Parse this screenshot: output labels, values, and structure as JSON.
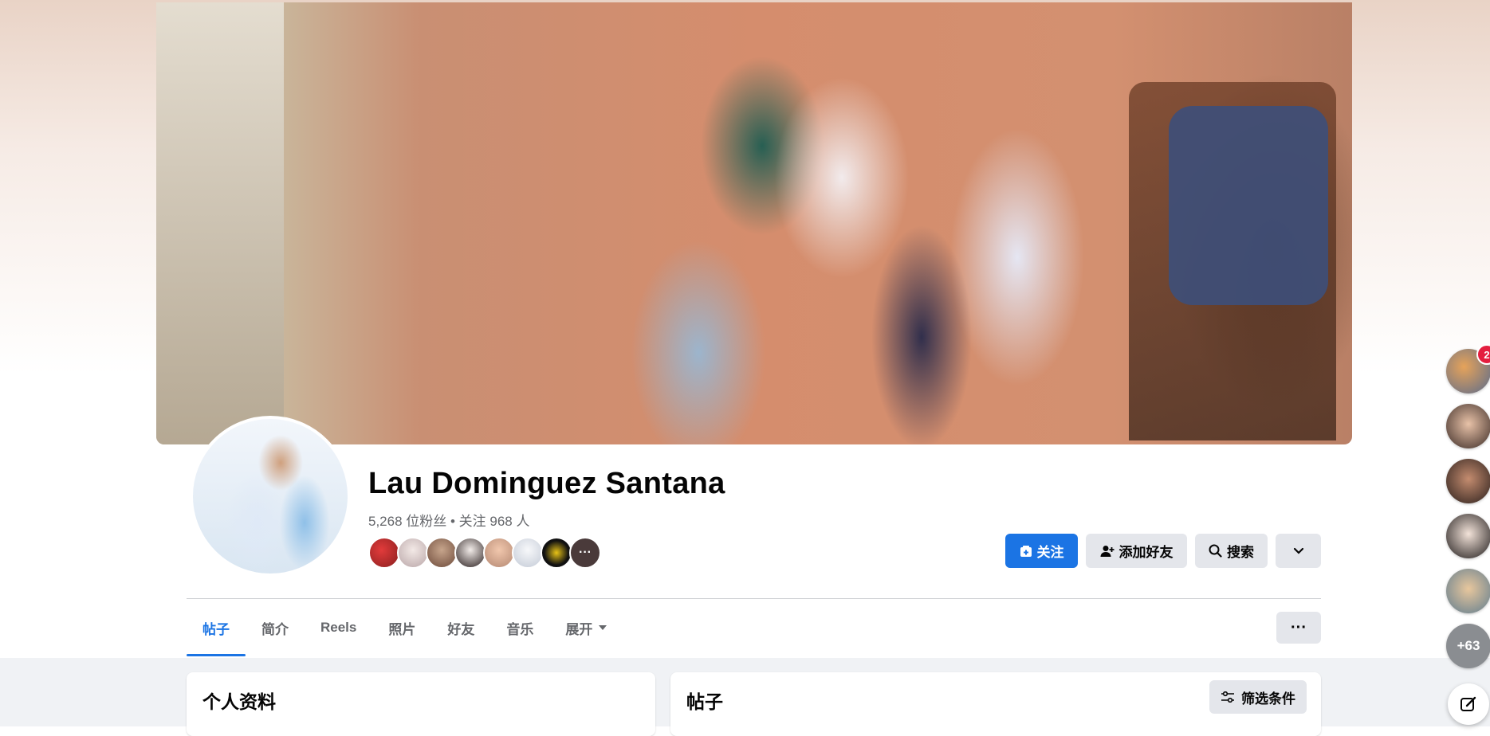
{
  "profile": {
    "name": "Lau Dominguez Santana",
    "followers_line": "5,268 位粉丝 • 关注 968 人",
    "friends_more": "···"
  },
  "actions": {
    "follow": "关注",
    "add_friend": "添加好友",
    "search": "搜索"
  },
  "tabs": [
    {
      "label": "帖子"
    },
    {
      "label": "简介"
    },
    {
      "label": "Reels"
    },
    {
      "label": "照片"
    },
    {
      "label": "好友"
    },
    {
      "label": "音乐"
    },
    {
      "label": "展开"
    }
  ],
  "tab_more_label": "···",
  "cards": {
    "intro_title": "个人资料",
    "posts_title": "帖子",
    "filter_label": "筛选条件"
  },
  "contacts": {
    "badge_count": "2",
    "more_count": "+63"
  },
  "colors": {
    "primary": "#1b74e4",
    "secondary_button": "#e4e6eb",
    "page_bg": "#f0f2f5",
    "badge": "#e41e3f"
  }
}
